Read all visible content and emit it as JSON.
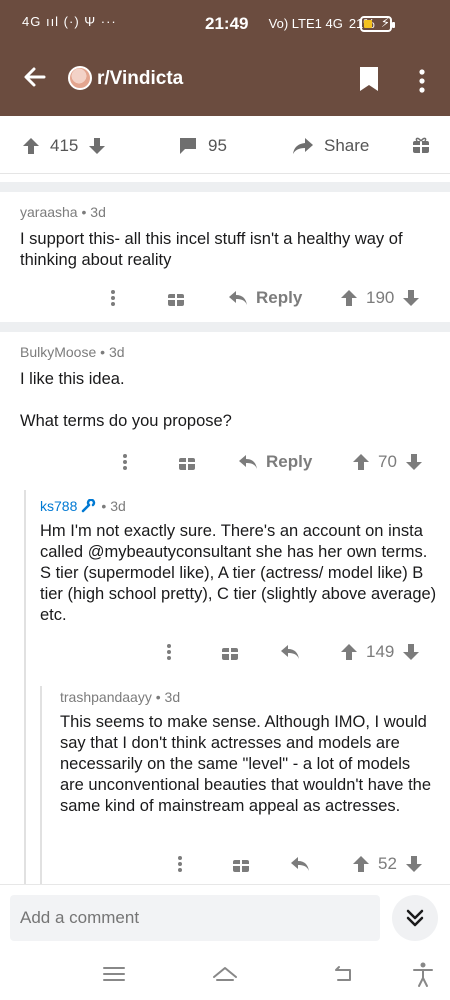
{
  "status": {
    "left_indicators": "4G ııl (·) Ψ ···",
    "time": "21:49",
    "right_indicators": "Vo) LTE1 4G",
    "battery": "21%"
  },
  "header": {
    "subreddit": "r/Vindicta",
    "colors": {
      "bar": "#6b4c3f",
      "avatar": "#e3a58f"
    }
  },
  "post_actions": {
    "upvotes": "415",
    "comments": "95",
    "share_label": "Share"
  },
  "comments": [
    {
      "author": "yaraasha",
      "age": "3d",
      "text": "I support this- all this incel stuff isn't a healthy way of thinking about reality",
      "reply_label": "Reply",
      "score": "190"
    },
    {
      "author": "BulkyMoose",
      "age": "3d",
      "text_line1": "I like this idea.",
      "text_line2": "What terms do you propose?",
      "reply_label": "Reply",
      "score": "70"
    },
    {
      "author": "ks788",
      "age": "3d",
      "author_color": "#0079d3",
      "text": "Hm I'm not exactly sure. There's an account on insta called @mybeautyconsultant she has her own terms. S tier (supermodel like), A tier (actress/ model like) B tier (high school pretty), C tier (slightly above average) etc.",
      "score": "149"
    },
    {
      "author": "trashpandaayy",
      "age": "3d",
      "text": "This seems to make sense. Although IMO, I would say that I don't think actresses and models are necessarily on the same \"level\" - a lot of models are unconventional beauties that wouldn't have the same kind of mainstream appeal as actresses.",
      "score": "52"
    }
  ],
  "comment_bar": {
    "placeholder": "Add a comment"
  }
}
